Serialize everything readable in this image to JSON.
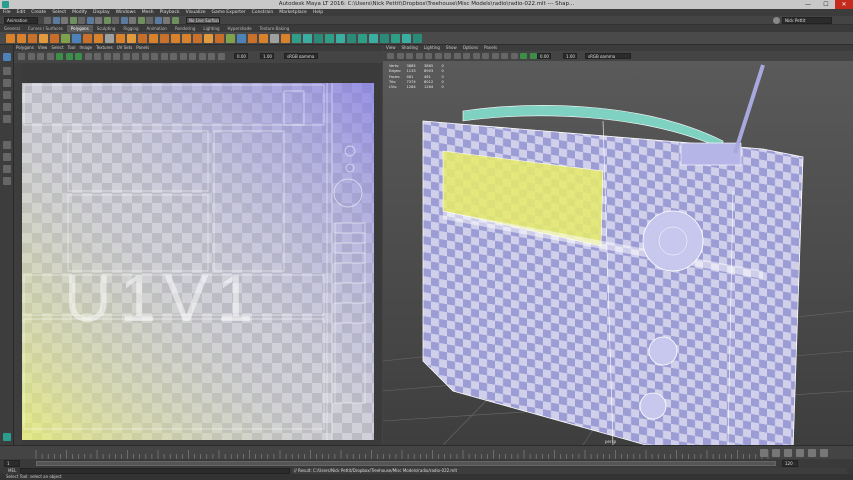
{
  "window": {
    "title": "Autodesk Maya LT 2016: C:\\Users\\Nick Pettit\\Dropbox\\Treehouse\\Misc Models\\radio\\radio-022.mlt --- Shap...",
    "minimize": "—",
    "maximize": "☐",
    "close": "✕"
  },
  "menubar": {
    "items": [
      "File",
      "Edit",
      "Create",
      "Select",
      "Modify",
      "Display",
      "Windows",
      "Mesh",
      "Playback",
      "Visualize",
      "Game Exporter",
      "Constrain",
      "Marketplace",
      "Help"
    ]
  },
  "statusline": {
    "mode": "Animation",
    "no_live_surface": "No Live Surface",
    "user": "Nick Pettit"
  },
  "shelf": {
    "tabs": [
      "General",
      "Curves / Surfaces",
      "Polygons",
      "Sculpting",
      "Rigging",
      "Animation",
      "Rendering",
      "Lighting",
      "Hypershade",
      "Texture Baking"
    ],
    "active_tab": "Polygons"
  },
  "uv_editor": {
    "menu": [
      "Polygons",
      "View",
      "Select",
      "Tool",
      "Image",
      "Textures",
      "UV Sets",
      "Panels"
    ],
    "value_a": "0.00",
    "value_b": "1.00",
    "colorspace": "sRGB gamma",
    "watermark": "U1V1"
  },
  "viewport": {
    "menu": [
      "View",
      "Shading",
      "Lighting",
      "Show",
      "Options",
      "Panels"
    ],
    "value_a": "0.00",
    "value_b": "1.00",
    "colorspace": "sRGB gamma",
    "hud": [
      {
        "label": "Verts:",
        "c1": "3885",
        "c2": "3885",
        "c3": "0"
      },
      {
        "label": "Edges:",
        "c1": "1133",
        "c2": "8903",
        "c3": "0"
      },
      {
        "label": "Faces:",
        "c1": "461",
        "c2": "461",
        "c3": "0"
      },
      {
        "label": "Tris:",
        "c1": "7374",
        "c2": "8012",
        "c3": "0"
      },
      {
        "label": "UVs:",
        "c1": "1284",
        "c2": "1284",
        "c3": "0"
      }
    ],
    "corner_label": "persp"
  },
  "timeline": {
    "start_frame": "1",
    "end_frame": "120"
  },
  "commandline": {
    "lang": "MEL",
    "result": "// Result: C:/Users/Nick Pettit/Dropbox/Treehouse/Misc Models/radio/radio-022.mlt"
  },
  "helpline": {
    "text": "Select Tool: select an object"
  }
}
